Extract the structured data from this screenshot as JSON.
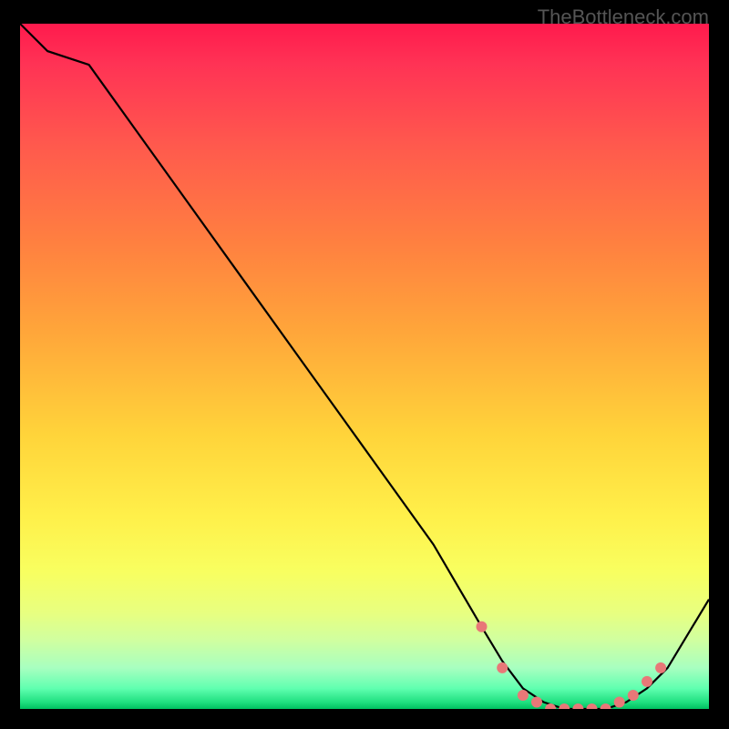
{
  "watermark": "TheBottleneck.com",
  "chart_data": {
    "type": "line",
    "title": "",
    "xlabel": "",
    "ylabel": "",
    "xlim": [
      0,
      100
    ],
    "ylim": [
      0,
      100
    ],
    "series": [
      {
        "name": "curve",
        "x": [
          0,
          4,
          10,
          20,
          30,
          40,
          50,
          60,
          67,
          70,
          73,
          76,
          79,
          82,
          85,
          88,
          91,
          94,
          100
        ],
        "y": [
          100,
          96,
          94,
          80,
          66,
          52,
          38,
          24,
          12,
          7,
          3,
          1,
          0,
          0,
          0,
          1,
          3,
          6,
          16
        ]
      }
    ],
    "markers": {
      "name": "highlight-dots",
      "color": "#e87878",
      "x": [
        67,
        70,
        73,
        75,
        77,
        79,
        81,
        83,
        85,
        87,
        89,
        91,
        93
      ],
      "y": [
        12,
        6,
        2,
        1,
        0,
        0,
        0,
        0,
        0,
        1,
        2,
        4,
        6
      ]
    }
  }
}
